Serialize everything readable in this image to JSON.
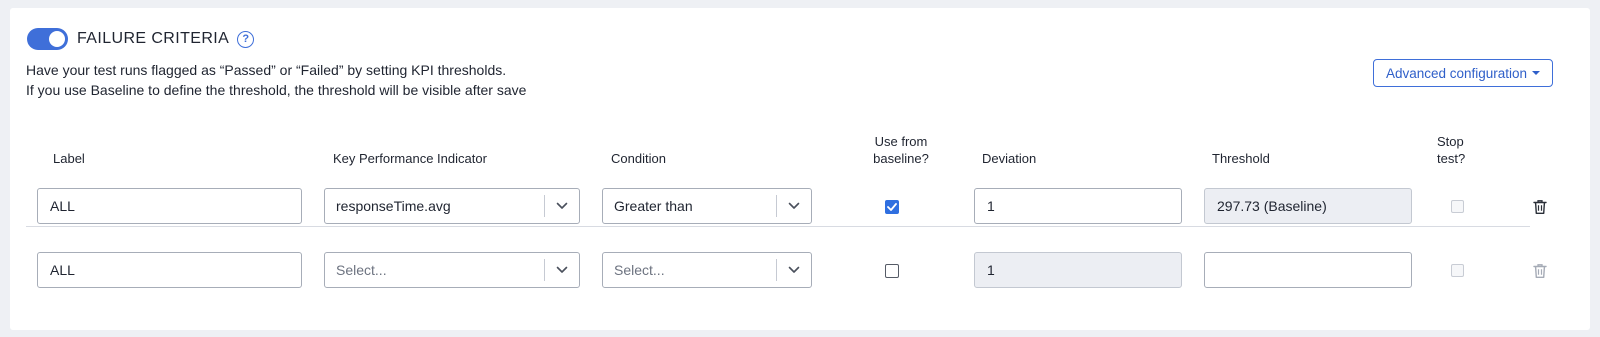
{
  "header": {
    "title": "FAILURE CRITERIA",
    "help_icon": "question-circle-icon",
    "toggle_on": true
  },
  "description": {
    "line1": "Have your test runs flagged as “Passed” or “Failed” by setting KPI thresholds.",
    "line2": "If you use Baseline to define the threshold, the threshold will be visible after save"
  },
  "advanced_button": {
    "label": "Advanced configuration"
  },
  "columns": {
    "label": "Label",
    "kpi": "Key Performance Indicator",
    "condition": "Condition",
    "use_baseline_line1": "Use from",
    "use_baseline_line2": "baseline?",
    "deviation": "Deviation",
    "threshold": "Threshold",
    "stop_line1": "Stop",
    "stop_line2": "test?"
  },
  "rows": [
    {
      "label": "ALL",
      "kpi": "responseTime.avg",
      "condition": "Greater than",
      "use_baseline": true,
      "deviation": "1",
      "threshold": "297.73 (Baseline)",
      "stop_test": false
    },
    {
      "label": "ALL",
      "kpi_placeholder": "Select...",
      "condition_placeholder": "Select...",
      "use_baseline": false,
      "deviation": "1",
      "threshold": "",
      "stop_test": false
    }
  ],
  "colors": {
    "accent": "#3f6fd9",
    "checkbox_checked": "#2f6fe0",
    "disabled_field": "#eceef3",
    "background": "#eef0f4"
  }
}
